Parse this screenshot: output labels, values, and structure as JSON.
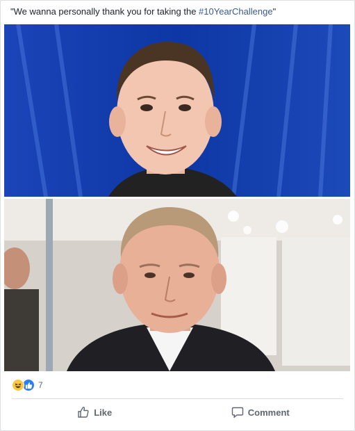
{
  "post": {
    "caption_before": "\"We wanna personally thank you for taking the ",
    "hashtag": "#10YearChallenge",
    "caption_after": "\""
  },
  "photos": {
    "top": "portrait-photo-smiling-man-blue-background",
    "bottom": "portrait-photo-man-in-suit"
  },
  "reactions": {
    "icons": [
      "haha-icon",
      "like-icon"
    ],
    "count": "7"
  },
  "actions": {
    "like_label": "Like",
    "comment_label": "Comment"
  },
  "colors": {
    "hashtag": "#385898",
    "action_text": "#606770",
    "like_blue": "#2e7df6",
    "haha_yellow": "#f7c846"
  }
}
